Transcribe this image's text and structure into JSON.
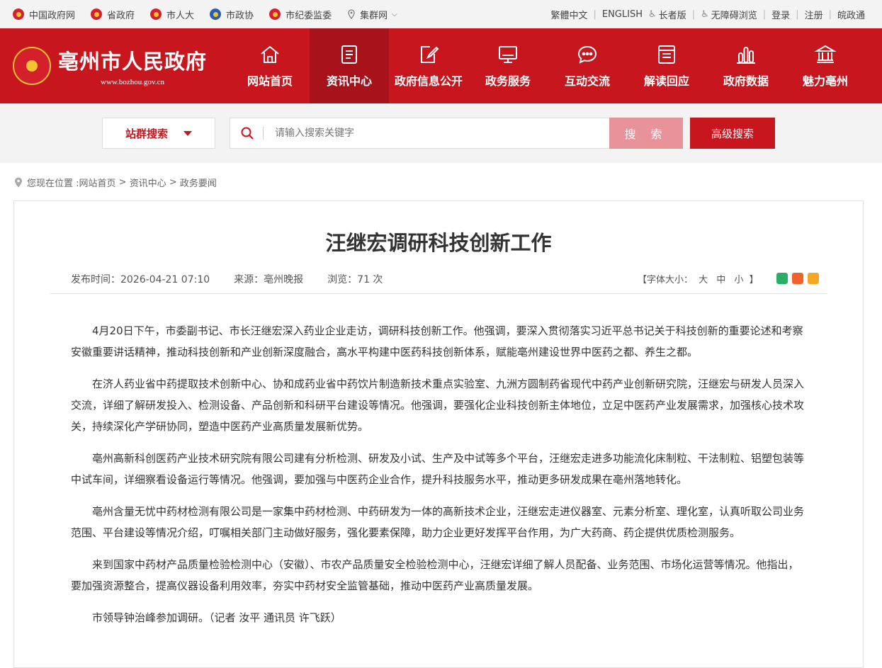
{
  "topbar": {
    "links": [
      "中国政府网",
      "省政府",
      "市人大",
      "市政协",
      "市纪委监委"
    ],
    "site_group": "集群网",
    "right_links": [
      "繁體中文",
      "ENGLISH",
      "长者版",
      "无障碍浏览",
      "登录",
      "注册",
      "皖政通"
    ]
  },
  "header": {
    "title": "亳州市人民政府",
    "url": "www.bozhou.gov.cn",
    "nav": [
      "网站首页",
      "资讯中心",
      "政府信息公开",
      "政务服务",
      "互动交流",
      "解读回应",
      "政府数据",
      "魅力亳州"
    ],
    "active_index": 1
  },
  "search": {
    "site_select": "站群搜索",
    "placeholder": "请输入搜索关键字",
    "button": "搜 索",
    "advanced": "高级搜索"
  },
  "breadcrumb": {
    "prefix": "您现在位置 : ",
    "items": [
      "网站首页",
      "资讯中心",
      "政务要闻"
    ]
  },
  "article": {
    "title": "汪继宏调研科技创新工作",
    "publish": "发布时间：2026-04-21 07:10",
    "source": "来源：亳州晚报",
    "views": "浏览：71 次",
    "font_label": "【字体大小：",
    "font_sizes": [
      "大",
      "中",
      "小"
    ],
    "font_end": "】",
    "paragraphs": [
      "4月20日下午，市委副书记、市长汪继宏深入药业企业走访，调研科技创新工作。他强调，要深入贯彻落实习近平总书记关于科技创新的重要论述和考察安徽重要讲话精神，推动科技创新和产业创新深度融合，高水平构建中医药科技创新体系，赋能亳州建设世界中医药之都、养生之都。",
      "在济人药业省中药提取技术创新中心、协和成药业省中药饮片制造新技术重点实验室、九洲方圆制药省现代中药产业创新研究院，汪继宏与研发人员深入交流，详细了解研发投入、检测设备、产品创新和科研平台建设等情况。他强调，要强化企业科技创新主体地位，立足中医药产业发展需求，加强核心技术攻关，持续深化产学研协同，塑造中医药产业高质量发展新优势。",
      "亳州高新科创医药产业技术研究院有限公司建有分析检测、研发及小试、生产及中试等多个平台，汪继宏走进多功能流化床制粒、干法制粒、铝塑包装等中试车间，详细察看设备运行等情况。他强调，要加强与中医药企业合作，提升科技服务水平，推动更多研发成果在亳州落地转化。",
      "亳州含量无忧中药材检测有限公司是一家集中药材检测、中药研发为一体的高新技术企业，汪继宏走进仪器室、元素分析室、理化室，认真听取公司业务范围、平台建设等情况介绍，叮嘱相关部门主动做好服务，强化要素保障，助力企业更好发挥平台作用，为广大药商、药企提供优质检测服务。",
      "来到国家中药材产品质量检验检测中心（安徽）、市农产品质量安全检验检测中心，汪继宏详细了解人员配备、业务范围、市场化运营等情况。他指出，要加强资源整合，提高仪器设备利用效率，夯实中药材安全监管基础，推动中医药产业高质量发展。",
      "市领导钟治峰参加调研。（记者 汝平 通讯员 许飞跃）"
    ]
  },
  "colors": {
    "brand_red": "#c8161e",
    "active_nav": "#a8121a",
    "search_btn": "#e8939a"
  }
}
